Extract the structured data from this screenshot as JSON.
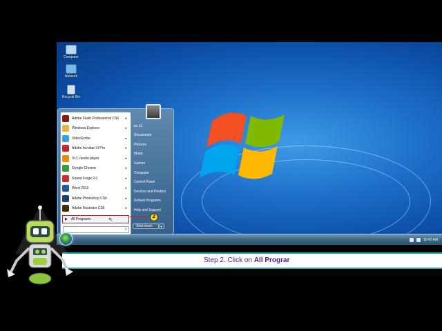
{
  "desktop": {
    "icons": [
      {
        "label": "Computer",
        "icon": "computer-icon"
      },
      {
        "label": "Network",
        "icon": "network-icon"
      },
      {
        "label": "Recycle Bin",
        "icon": "recycle-bin-icon"
      }
    ]
  },
  "start_menu": {
    "programs": [
      {
        "label": "Adobe Flash Professional CS6",
        "color": "#8b1a1a",
        "has_arrow": true
      },
      {
        "label": "Windows Explorer",
        "color": "#e0b740",
        "has_arrow": true
      },
      {
        "label": "VideoScribe",
        "color": "#3aa0d8",
        "has_arrow": true
      },
      {
        "label": "Adobe Acrobat XI Pro",
        "color": "#c0282e",
        "has_arrow": true
      },
      {
        "label": "VLC media player",
        "color": "#f08a00",
        "has_arrow": true
      },
      {
        "label": "Google Chrome",
        "color": "#3f9a3f",
        "has_arrow": true
      },
      {
        "label": "Sound Forge 9.0",
        "color": "#c73030",
        "has_arrow": true
      },
      {
        "label": "Word 2013",
        "color": "#2b5797",
        "has_arrow": true
      },
      {
        "label": "Adobe Photoshop CS6",
        "color": "#1f3f6e",
        "has_arrow": true
      },
      {
        "label": "Adobe Illustrator CS6",
        "color": "#4a2a00",
        "has_arrow": true
      }
    ],
    "all_programs_label": "All Programs",
    "search_placeholder": "",
    "right_items": [
      "pc n1",
      "Documents",
      "Pictures",
      "Music",
      "Games",
      "Computer",
      "Control Panel",
      "Devices and Printers",
      "Default Programs",
      "Help and Support"
    ],
    "shutdown_label": "Shut down"
  },
  "taskbar": {
    "clock": "10:42 AM"
  },
  "callout": {
    "number": "2"
  },
  "caption": {
    "prefix": "Step 2. Click on ",
    "bold": "All Prograr"
  }
}
